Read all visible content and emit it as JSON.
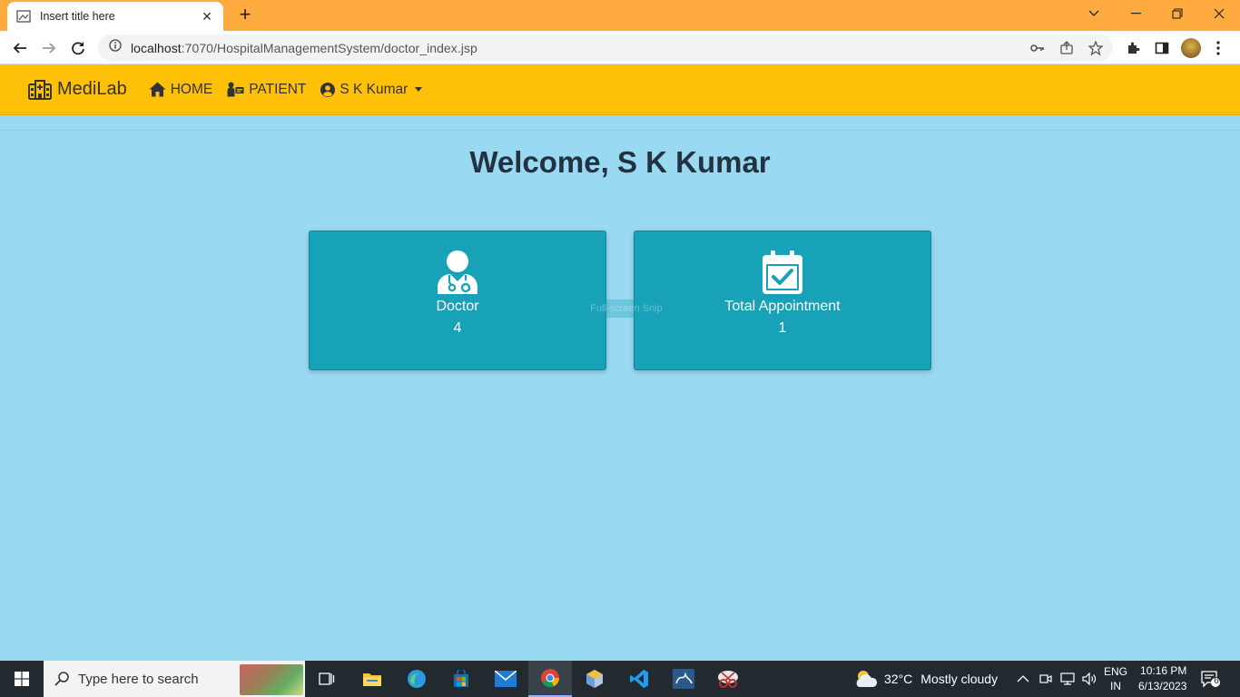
{
  "browser": {
    "tab_title": "Insert title here",
    "tab_close": "✕",
    "new_tab": "+",
    "url_host": "localhost",
    "url_path": ":7070/HospitalManagementSystem/doctor_index.jsp"
  },
  "navbar": {
    "brand": "MediLab",
    "home": "HOME",
    "patient": "PATIENT",
    "user": "S K Kumar",
    "bg_color": "#ffc107"
  },
  "main": {
    "welcome": "Welcome, S K Kumar",
    "cards": [
      {
        "label": "Doctor",
        "value": "4",
        "icon": "user-doctor-icon"
      },
      {
        "label": "Total Appointment",
        "value": "1",
        "icon": "calendar-check-icon"
      }
    ],
    "card_color": "#17a2b8",
    "snip_overlay": "Full-screen Snip"
  },
  "taskbar": {
    "search_placeholder": "Type here to search",
    "weather_temp": "32°C",
    "weather_text": "Mostly cloudy",
    "lang_top": "ENG",
    "lang_bottom": "IN",
    "time": "10:16 PM",
    "date": "6/13/2023",
    "notif_count": "6"
  }
}
